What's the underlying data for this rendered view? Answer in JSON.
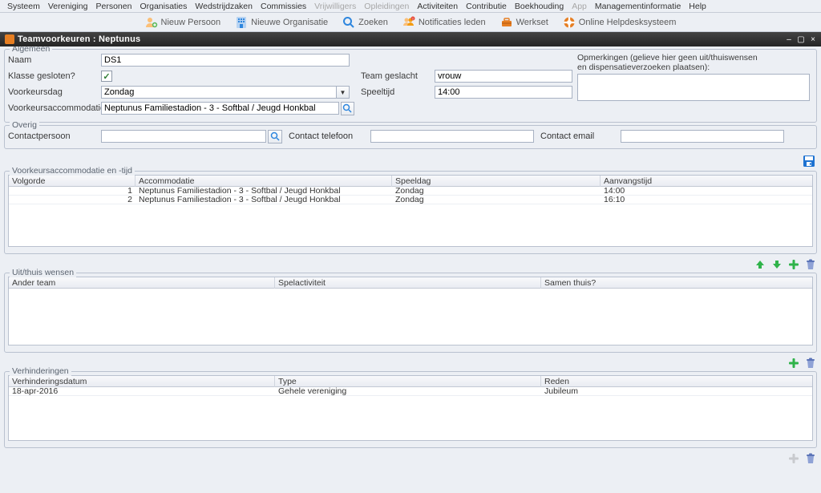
{
  "menubar": {
    "items": [
      {
        "label": "Systeem",
        "enabled": true
      },
      {
        "label": "Vereniging",
        "enabled": true
      },
      {
        "label": "Personen",
        "enabled": true
      },
      {
        "label": "Organisaties",
        "enabled": true
      },
      {
        "label": "Wedstrijdzaken",
        "enabled": true
      },
      {
        "label": "Commissies",
        "enabled": true
      },
      {
        "label": "Vrijwilligers",
        "enabled": false
      },
      {
        "label": "Opleidingen",
        "enabled": false
      },
      {
        "label": "Activiteiten",
        "enabled": true
      },
      {
        "label": "Contributie",
        "enabled": true
      },
      {
        "label": "Boekhouding",
        "enabled": true
      },
      {
        "label": "App",
        "enabled": false
      },
      {
        "label": "Managementinformatie",
        "enabled": true
      },
      {
        "label": "Help",
        "enabled": true
      }
    ]
  },
  "toolbar": {
    "items": [
      {
        "label": "Nieuw Persoon",
        "icon": "person-plus",
        "color": "#e67e22"
      },
      {
        "label": "Nieuwe Organisatie",
        "icon": "org",
        "color": "#2e86de"
      },
      {
        "label": "Zoeken",
        "icon": "search",
        "color": "#2e86de"
      },
      {
        "label": "Notificaties leden",
        "icon": "bell-people",
        "color": "#e67e22"
      },
      {
        "label": "Werkset",
        "icon": "toolbox",
        "color": "#e67e22"
      },
      {
        "label": "Online Helpdesksysteem",
        "icon": "helpdesk",
        "color": "#e67e22"
      }
    ]
  },
  "tab": {
    "title": "Teamvoorkeuren : Neptunus"
  },
  "groups": {
    "algemeen": {
      "legend": "Algemeen",
      "naam_label": "Naam",
      "naam_value": "DS1",
      "klasse_label": "Klasse gesloten?",
      "klasse_checked": true,
      "voorkeursdag_label": "Voorkeursdag",
      "voorkeursdag_value": "Zondag",
      "voorkeursaccommodatie_label": "Voorkeursaccommodatie",
      "voorkeursaccommodatie_value": "Neptunus Familiestadion - 3 - Softbal / Jeugd Honkbal",
      "team_geslacht_label": "Team geslacht",
      "team_geslacht_value": "vrouw",
      "speeltijd_label": "Speeltijd",
      "speeltijd_value": "14:00",
      "opm_line1": "Opmerkingen (gelieve hier geen uit/thuiswensen",
      "opm_line2": "en dispensatieverzoeken plaatsen):"
    },
    "overig": {
      "legend": "Overig",
      "contactpersoon_label": "Contactpersoon",
      "contact_telefoon_label": "Contact telefoon",
      "contact_email_label": "Contact email"
    },
    "voorkeursaccommodatie": {
      "legend": "Voorkeursaccommodatie en -tijd",
      "headers": {
        "volgorde": "Volgorde",
        "accommodatie": "Accommodatie",
        "speeldag": "Speeldag",
        "aanvangstijd": "Aanvangstijd"
      },
      "rows": [
        {
          "volgorde": "1",
          "accommodatie": "Neptunus Familiestadion - 3 - Softbal / Jeugd Honkbal",
          "speeldag": "Zondag",
          "aanvangstijd": "14:00"
        },
        {
          "volgorde": "2",
          "accommodatie": "Neptunus Familiestadion - 3 - Softbal / Jeugd Honkbal",
          "speeldag": "Zondag",
          "aanvangstijd": "16:10"
        }
      ]
    },
    "uitthuis": {
      "legend": "Uit/thuis wensen",
      "headers": {
        "ander_team": "Ander team",
        "spelactiviteit": "Spelactiviteit",
        "samen_thuis": "Samen thuis?"
      }
    },
    "verhinderingen": {
      "legend": "Verhinderingen",
      "headers": {
        "datum": "Verhinderingsdatum",
        "type": "Type",
        "reden": "Reden"
      },
      "rows": [
        {
          "datum": "18-apr-2016",
          "type": "Gehele vereniging",
          "reden": "Jubileum"
        }
      ]
    }
  }
}
